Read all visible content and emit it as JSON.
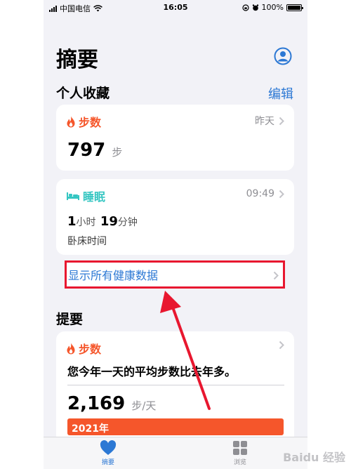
{
  "status_bar": {
    "carrier": "中国电信",
    "time": "16:05",
    "battery": "100%",
    "battery_level": 1.0
  },
  "page_title": "摘要",
  "favorites": {
    "heading": "个人收藏",
    "edit_label": "编辑",
    "steps_card": {
      "title": "步数",
      "meta": "昨天",
      "value": "797",
      "unit": "步",
      "icon": "flame-icon"
    },
    "sleep_card": {
      "title": "睡眠",
      "meta": "09:49",
      "hours": "1",
      "hours_unit": "小时",
      "minutes": "19",
      "minutes_unit": "分钟",
      "subtitle": "卧床时间",
      "icon": "bed-icon"
    },
    "show_all_label": "显示所有健康数据"
  },
  "highlights": {
    "heading": "提要",
    "card": {
      "title": "步数",
      "icon": "flame-icon",
      "text": "您今年一天的平均步数比去年多。",
      "value": "2,169",
      "unit": "步",
      "per_day": "/天",
      "year_label": "2021年"
    }
  },
  "tab_bar": {
    "summary_label": "摘要",
    "browse_label": "浏览"
  },
  "watermark": "Baidu 经验",
  "colors": {
    "accent_blue": "#2c78d4",
    "steps_orange": "#f5562b",
    "sleep_teal": "#35c6c2",
    "highlight_red": "#e8172f"
  }
}
